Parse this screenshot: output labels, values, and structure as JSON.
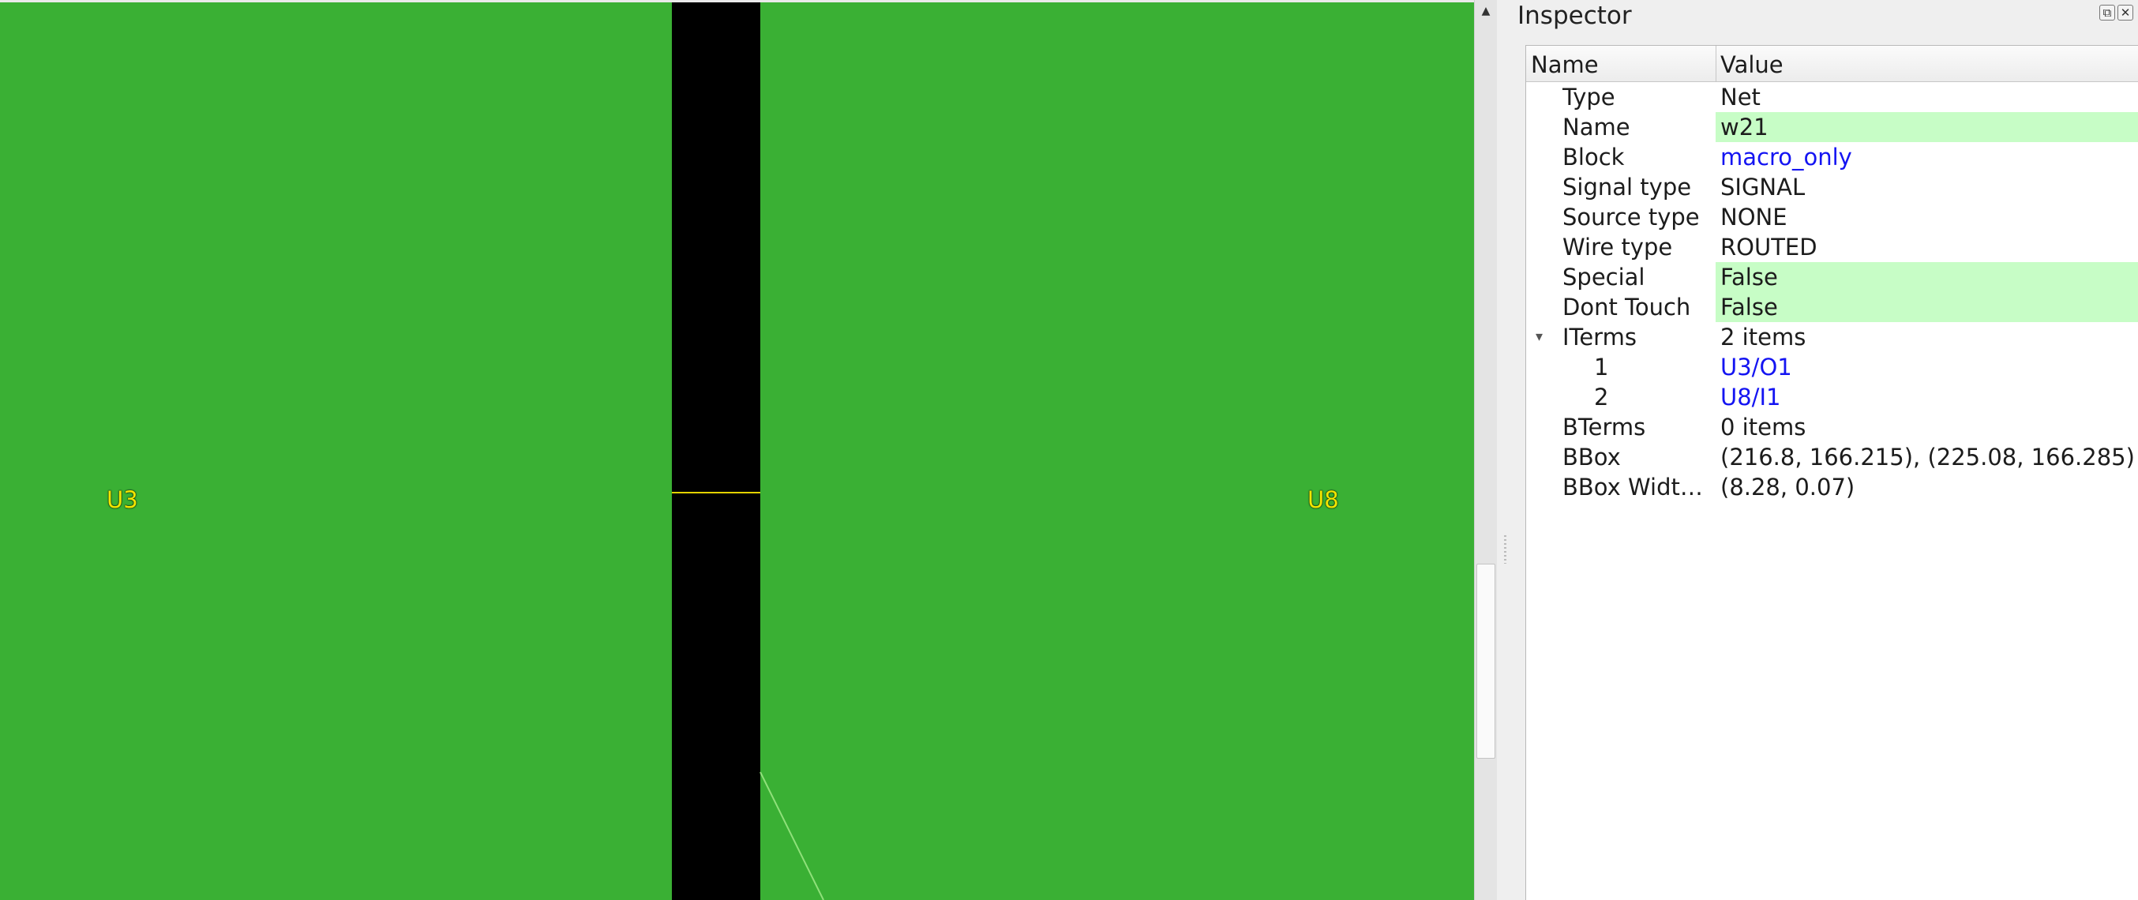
{
  "layout": {
    "instances": [
      {
        "label": "U3"
      },
      {
        "label": "U8"
      }
    ],
    "colors": {
      "cell_fill": "#3ab034",
      "channel": "#000000",
      "wire": "#e3d100",
      "label": "#f2e600"
    }
  },
  "scrollbar": {
    "up_arrow_icon": "triangle-up-icon",
    "position": 0.73
  },
  "inspector": {
    "title": "Inspector",
    "float_icon": "float-icon",
    "close_icon": "close-icon",
    "columns": {
      "name": "Name",
      "value": "Value"
    },
    "rows": [
      {
        "name": "Type",
        "value": "Net"
      },
      {
        "name": "Name",
        "value": "w21"
      },
      {
        "name": "Block",
        "value": "macro_only"
      },
      {
        "name": "Signal type",
        "value": "SIGNAL"
      },
      {
        "name": "Source type",
        "value": "NONE"
      },
      {
        "name": "Wire type",
        "value": "ROUTED"
      },
      {
        "name": "Special",
        "value": "False"
      },
      {
        "name": "Dont Touch",
        "value": "False"
      },
      {
        "name": "ITerms",
        "value": "2 items",
        "expanded": true
      },
      {
        "name": "1",
        "value": "U3/O1"
      },
      {
        "name": "2",
        "value": "U8/I1"
      },
      {
        "name": "BTerms",
        "value": "0 items"
      },
      {
        "name": "BBox",
        "value": "(216.8, 166.215), (225.08, 166.285)"
      },
      {
        "name": "BBox Widt…",
        "value": "(8.28, 0.07)"
      }
    ],
    "colors": {
      "editable_bg": "#c7fdc6",
      "link": "#1414f2"
    }
  }
}
